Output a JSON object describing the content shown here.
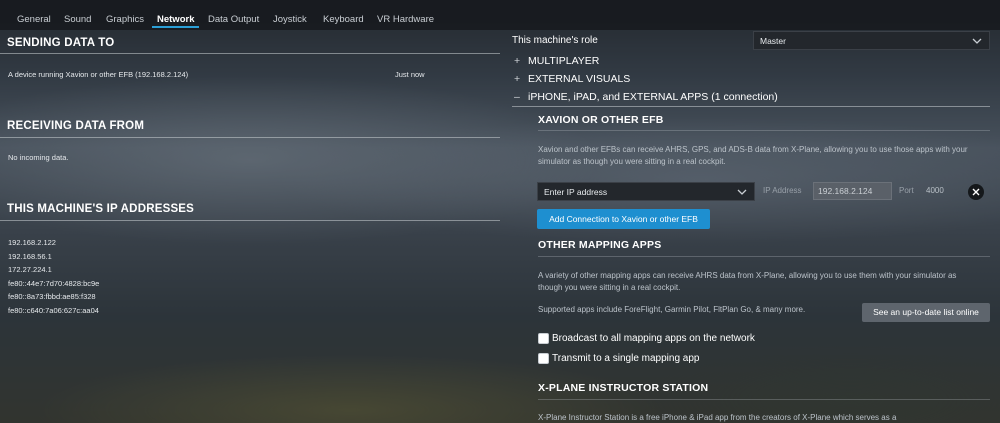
{
  "tabs": [
    {
      "label": "General"
    },
    {
      "label": "Sound"
    },
    {
      "label": "Graphics"
    },
    {
      "label": "Network"
    },
    {
      "label": "Data Output"
    },
    {
      "label": "Joystick"
    },
    {
      "label": "Keyboard"
    },
    {
      "label": "VR Hardware"
    }
  ],
  "active_tab": "Network",
  "left": {
    "sending": {
      "title": "SENDING DATA TO",
      "device": "A device running Xavion or other EFB (192.168.2.124)",
      "time": "Just now"
    },
    "receiving": {
      "title": "RECEIVING DATA FROM",
      "empty": "No incoming data."
    },
    "ip": {
      "title": "THIS MACHINE'S IP ADDRESSES",
      "addresses": [
        "192.168.2.122",
        "192.168.56.1",
        "172.27.224.1",
        "fe80::44e7:7d70:4828:bc9e",
        "fe80::8a73:fbbd:ae85:f328",
        "fe80::c640:7a06:627c:aa04"
      ]
    }
  },
  "right": {
    "role_label": "This machine's role",
    "role_value": "Master",
    "sections": [
      {
        "glyph": "+",
        "label": "MULTIPLAYER"
      },
      {
        "glyph": "+",
        "label": "EXTERNAL VISUALS"
      },
      {
        "glyph": "–",
        "label": "iPHONE, iPAD, and EXTERNAL APPS (1 connection)"
      }
    ],
    "xavion": {
      "title": "XAVION OR OTHER EFB",
      "desc": "Xavion and other EFBs can receive AHRS, GPS, and ADS-B data from X-Plane, allowing you to use those apps with your simulator as though you were sitting in a real cockpit.",
      "ip_select": "Enter IP address",
      "ip_label": "IP Address",
      "ip_value": "192.168.2.124",
      "port_label": "Port",
      "port_value": "4000",
      "add_button": "Add Connection to Xavion or other EFB"
    },
    "mapping": {
      "title": "OTHER MAPPING APPS",
      "desc": "A variety of other mapping apps can receive AHRS data from X-Plane, allowing you to use them with your simulator as though you were sitting in a real cockpit.",
      "supported": "Supported apps include ForeFlight, Garmin Pilot, FltPlan Go, & many more.",
      "list_button": "See an up-to-date list online",
      "broadcast": "Broadcast to all mapping apps on the network",
      "transmit": "Transmit to a single mapping app"
    },
    "instructor": {
      "title": "X-PLANE INSTRUCTOR STATION",
      "desc": "X-Plane Instructor Station is a free iPhone & iPad app from the creators of X-Plane which serves as a"
    }
  },
  "colors": {
    "accent": "#2b9fd6",
    "button_blue": "#1e8fd0",
    "button_gray": "#5e656d"
  }
}
